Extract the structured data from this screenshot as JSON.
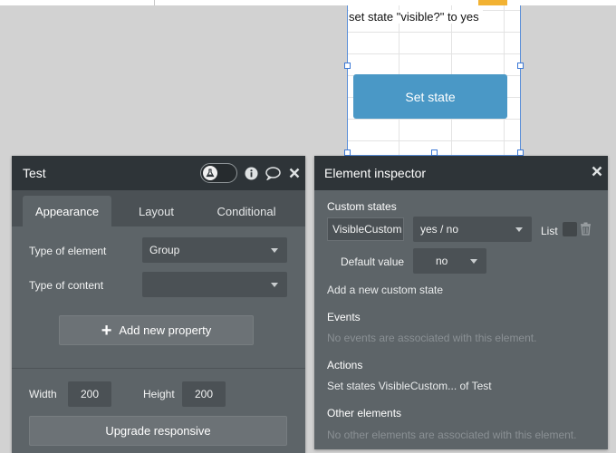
{
  "canvas": {
    "text_element": "set state \"visible?\" to yes",
    "button_label": "Set state"
  },
  "property_editor": {
    "title": "Test",
    "header_icons": [
      "flask-icon",
      "info-icon",
      "comment-icon",
      "close-icon"
    ],
    "tabs": [
      {
        "label": "Appearance",
        "active": true
      },
      {
        "label": "Layout",
        "active": false
      },
      {
        "label": "Conditional",
        "active": false
      }
    ],
    "type_of_element_label": "Type of element",
    "type_of_element_value": "Group",
    "type_of_content_label": "Type of content",
    "type_of_content_value": "",
    "add_property_label": "Add new property",
    "width_label": "Width",
    "width_value": "200",
    "height_label": "Height",
    "height_value": "200",
    "upgrade_label": "Upgrade responsive"
  },
  "inspector": {
    "title": "Element inspector",
    "custom_states_label": "Custom states",
    "state_name": "VisibleCustom",
    "state_type": "yes / no",
    "list_label": "List",
    "default_value_label": "Default value",
    "default_value": "no",
    "add_state_link": "Add a new custom state",
    "events_label": "Events",
    "events_empty": "No events are associated with this element.",
    "actions_label": "Actions",
    "actions_text": "Set states VisibleCustom... of Test",
    "other_label": "Other elements",
    "other_empty": "No other elements are associated with this element."
  },
  "colors": {
    "panel_bg": "#5d6468",
    "header_bg": "#2e3438",
    "button_blue": "#4a98c6",
    "selection_blue": "#3b78d6"
  }
}
